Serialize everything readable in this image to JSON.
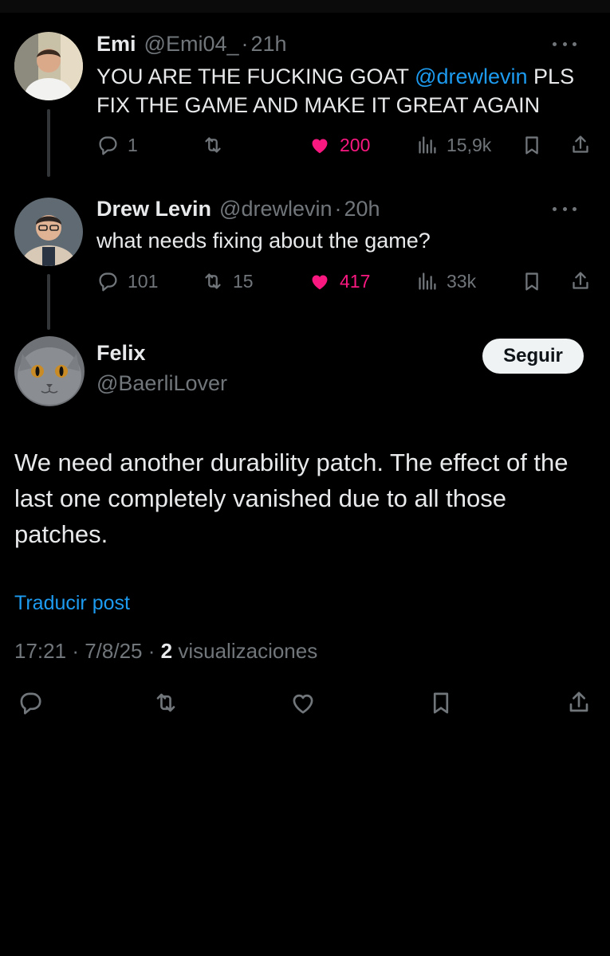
{
  "thread": [
    {
      "name": "Emi",
      "handle": "@Emi04_",
      "separator": "·",
      "time": "21h",
      "text_before": "YOU ARE THE FUCKING GOAT ",
      "mention": "@drewlevin",
      "text_after": " PLS FIX THE GAME AND MAKE IT GREAT AGAIN",
      "replies": "1",
      "reposts": "",
      "likes": "200",
      "views": "15,9k",
      "liked": true
    },
    {
      "name": "Drew Levin",
      "handle": "@drewlevin",
      "separator": "·",
      "time": "20h",
      "text": "what needs fixing about the game?",
      "replies": "101",
      "reposts": "15",
      "likes": "417",
      "views": "33k",
      "liked": true
    }
  ],
  "main_post": {
    "name": "Felix",
    "handle": "@BaerliLover",
    "follow_label": "Seguir",
    "text": "We need another durability patch. The effect of the last one completely vanished due to all those patches.",
    "translate_label": "Traducir post",
    "time": "17:21",
    "date": "7/8/25",
    "separator": "·",
    "views_count": "2",
    "views_label": "visualizaciones"
  },
  "icons": {
    "reply": "reply-icon",
    "repost": "repost-icon",
    "like": "heart-icon",
    "views": "views-icon",
    "bookmark": "bookmark-icon",
    "share": "share-icon",
    "more": "more-icon"
  },
  "colors": {
    "background": "#000000",
    "text": "#e7e9ea",
    "muted": "#71767b",
    "accent": "#1d9bf0",
    "like": "#f91880"
  }
}
